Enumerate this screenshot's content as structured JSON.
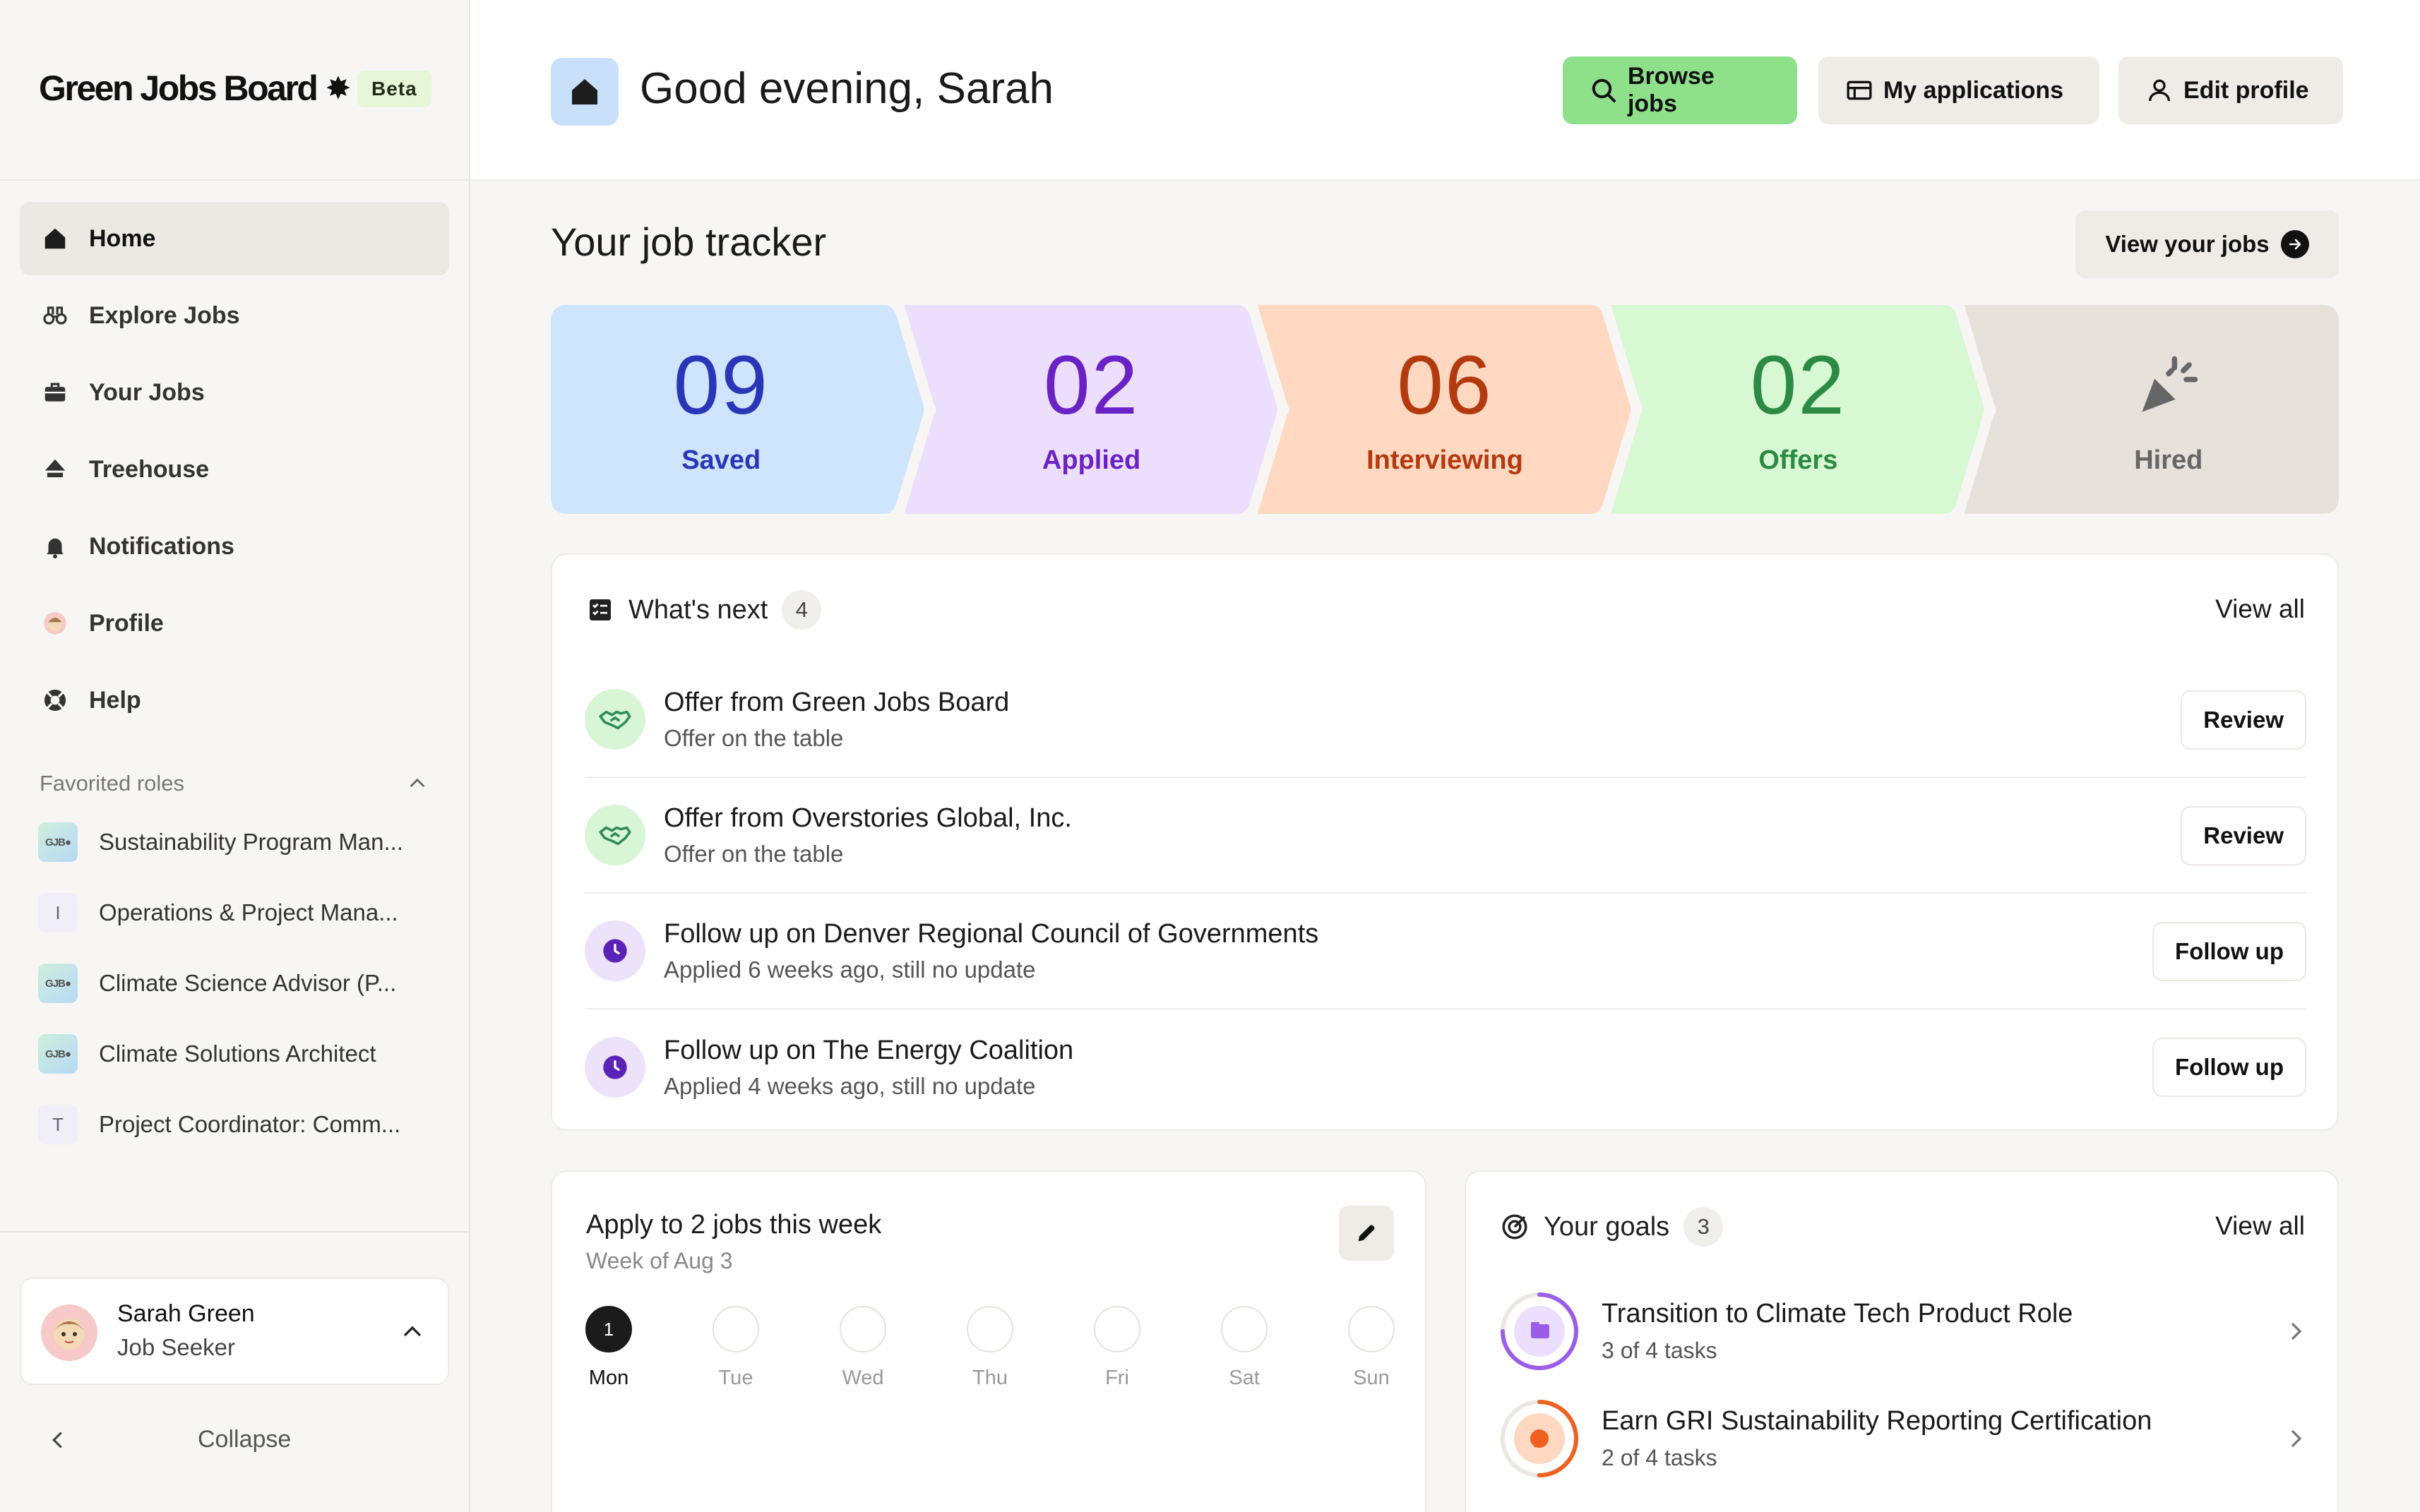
{
  "brand": {
    "name": "Green Jobs Board",
    "star": "✸",
    "badge": "Beta"
  },
  "nav": [
    {
      "label": "Home",
      "icon": "home-icon",
      "active": true
    },
    {
      "label": "Explore Jobs",
      "icon": "binoculars-icon"
    },
    {
      "label": "Your Jobs",
      "icon": "briefcase-icon"
    },
    {
      "label": "Treehouse",
      "icon": "treehouse-icon"
    },
    {
      "label": "Notifications",
      "icon": "bell-icon"
    },
    {
      "label": "Profile",
      "icon": "avatar-icon"
    },
    {
      "label": "Help",
      "icon": "lifebuoy-icon"
    }
  ],
  "favorites": {
    "heading": "Favorited roles",
    "items": [
      {
        "label": "Sustainability Program Man...",
        "logo": "GJB●"
      },
      {
        "label": "Operations & Project Mana...",
        "logo": "I"
      },
      {
        "label": "Climate Science Advisor (P...",
        "logo": "GJB●"
      },
      {
        "label": "Climate Solutions Architect",
        "logo": "GJB●"
      },
      {
        "label": "Project Coordinator: Comm...",
        "logo": "T"
      }
    ]
  },
  "user": {
    "name": "Sarah Green",
    "role": "Job Seeker"
  },
  "collapse_label": "Collapse",
  "header": {
    "greeting": "Good evening, Sarah",
    "browse_label": "Browse jobs",
    "applications_label": "My applications",
    "edit_profile_label": "Edit profile"
  },
  "tracker": {
    "title": "Your job tracker",
    "view_label": "View your jobs",
    "stages": [
      {
        "value": "09",
        "label": "Saved",
        "bg": "#cfe4fd",
        "color": "#2a36b8"
      },
      {
        "value": "02",
        "label": "Applied",
        "bg": "#ecdffd",
        "color": "#6a22c4"
      },
      {
        "value": "06",
        "label": "Interviewing",
        "bg": "#fed8c1",
        "color": "#b33a0f"
      },
      {
        "value": "02",
        "label": "Offers",
        "bg": "#d8f7d3",
        "color": "#2c8a44"
      },
      {
        "value": "",
        "label": "Hired",
        "bg": "#e6e1db",
        "color": "#666"
      }
    ]
  },
  "whats_next": {
    "title": "What's next",
    "count": "4",
    "view_all": "View all",
    "items": [
      {
        "title": "Offer from Green Jobs Board",
        "sub": "Offer on the table",
        "action": "Review",
        "kind": "offer"
      },
      {
        "title": "Offer from Overstories Global, Inc.",
        "sub": "Offer on the table",
        "action": "Review",
        "kind": "offer"
      },
      {
        "title": "Follow up on Denver Regional Council of Governments",
        "sub": "Applied 6 weeks ago, still no update",
        "action": "Follow up",
        "kind": "follow"
      },
      {
        "title": "Follow up on The Energy Coalition",
        "sub": "Applied 4 weeks ago, still no update",
        "action": "Follow up",
        "kind": "follow"
      }
    ]
  },
  "weekly": {
    "title": "Apply to 2 jobs this week",
    "sub": "Week of Aug 3",
    "days": [
      {
        "name": "Mon",
        "mark": "1",
        "done": true
      },
      {
        "name": "Tue",
        "mark": "",
        "done": false
      },
      {
        "name": "Wed",
        "mark": "",
        "done": false
      },
      {
        "name": "Thu",
        "mark": "",
        "done": false
      },
      {
        "name": "Fri",
        "mark": "",
        "done": false
      },
      {
        "name": "Sat",
        "mark": "",
        "done": false
      },
      {
        "name": "Sun",
        "mark": "",
        "done": false
      }
    ]
  },
  "goals": {
    "title": "Your goals",
    "count": "3",
    "view_all": "View all",
    "items": [
      {
        "title": "Transition to Climate Tech Product Role",
        "sub": "3 of 4 tasks",
        "progress": 0.75,
        "color": "#9b5ce8",
        "inner": "#ecdffd"
      },
      {
        "title": "Earn GRI Sustainability Reporting Certification",
        "sub": "2 of 4 tasks",
        "progress": 0.5,
        "color": "#f0601f",
        "inner": "#fed8c1"
      }
    ]
  }
}
